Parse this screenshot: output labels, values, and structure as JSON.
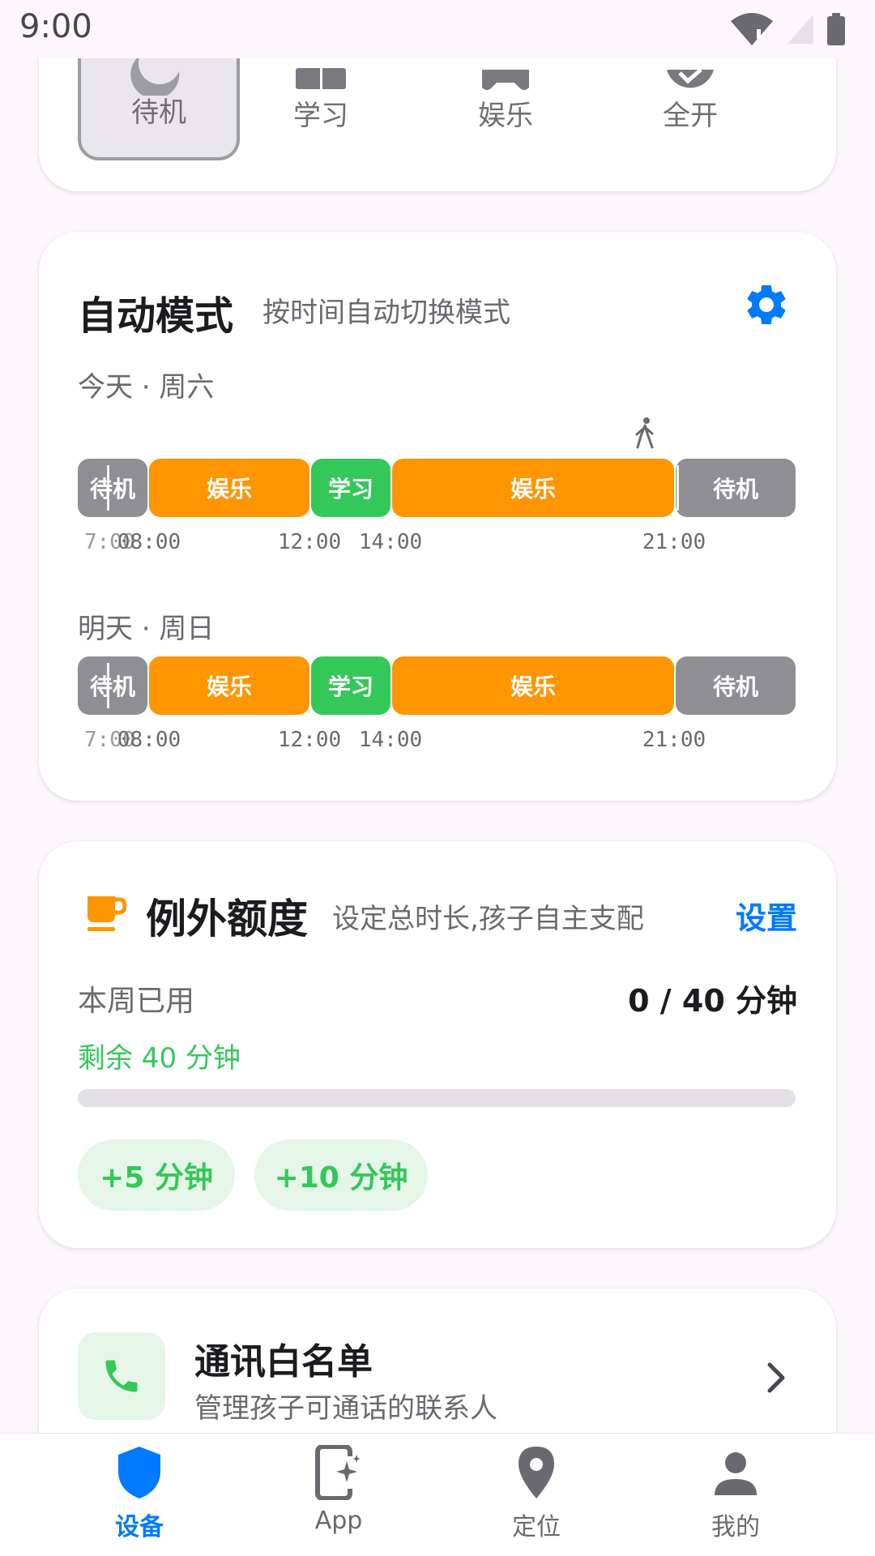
{
  "status_bar": {
    "time": "9:00"
  },
  "modes": {
    "items": [
      {
        "label": "待机",
        "icon": "moon-icon",
        "selected": true
      },
      {
        "label": "学习",
        "icon": "book-icon",
        "selected": false
      },
      {
        "label": "娱乐",
        "icon": "gamepad-icon",
        "selected": false
      },
      {
        "label": "全开",
        "icon": "check-circle-icon",
        "selected": false
      }
    ]
  },
  "auto_mode": {
    "title": "自动模式",
    "subtitle": "按时间自动切换模式",
    "settings_icon": "gear-icon",
    "days": [
      {
        "label": "今天 · 周六",
        "segments": [
          {
            "mode": "standby",
            "label": "待机",
            "start": "06:00",
            "end": "08:00"
          },
          {
            "mode": "fun",
            "label": "娱乐",
            "start": "08:00",
            "end": "12:00"
          },
          {
            "mode": "study",
            "label": "学习",
            "start": "12:00",
            "end": "14:00"
          },
          {
            "mode": "fun",
            "label": "娱乐",
            "start": "14:00",
            "end": "21:00"
          },
          {
            "mode": "standby",
            "label": "待机",
            "start": "21:00",
            "end": "24:00"
          }
        ],
        "ticks": [
          "7:00",
          "08:00",
          "12:00",
          "14:00",
          "21:00"
        ]
      },
      {
        "label": "明天 · 周日",
        "segments": [
          {
            "mode": "standby",
            "label": "待机",
            "start": "06:00",
            "end": "08:00"
          },
          {
            "mode": "fun",
            "label": "娱乐",
            "start": "08:00",
            "end": "12:00"
          },
          {
            "mode": "study",
            "label": "学习",
            "start": "12:00",
            "end": "14:00"
          },
          {
            "mode": "fun",
            "label": "娱乐",
            "start": "14:00",
            "end": "21:00"
          },
          {
            "mode": "standby",
            "label": "待机",
            "start": "21:00",
            "end": "24:00"
          }
        ],
        "ticks": [
          "7:00",
          "08:00",
          "12:00",
          "14:00",
          "21:00"
        ]
      }
    ],
    "colors": {
      "standby": "#8E8E93",
      "fun": "#FF9500",
      "study": "#34C759"
    }
  },
  "quota": {
    "icon": "cup-icon",
    "title": "例外额度",
    "subtitle": "设定总时长,孩子自主支配",
    "settings_link": "设置",
    "used_label": "本周已用",
    "used_value": "0 / 40 分钟",
    "remaining": "剩余 40 分钟",
    "progress_fraction": 0,
    "chips": [
      "+5 分钟",
      "+10 分钟"
    ]
  },
  "whitelist": {
    "icon": "phone-icon",
    "title": "通讯白名单",
    "subtitle": "管理孩子可通话的联系人"
  },
  "bottom_nav": {
    "items": [
      {
        "label": "设备",
        "icon": "shield-icon",
        "active": true
      },
      {
        "label": "App",
        "icon": "app-sparkle-icon",
        "active": false
      },
      {
        "label": "定位",
        "icon": "location-pin-icon",
        "active": false
      },
      {
        "label": "我的",
        "icon": "person-icon",
        "active": false
      }
    ]
  },
  "accent_color": "#007AFF"
}
